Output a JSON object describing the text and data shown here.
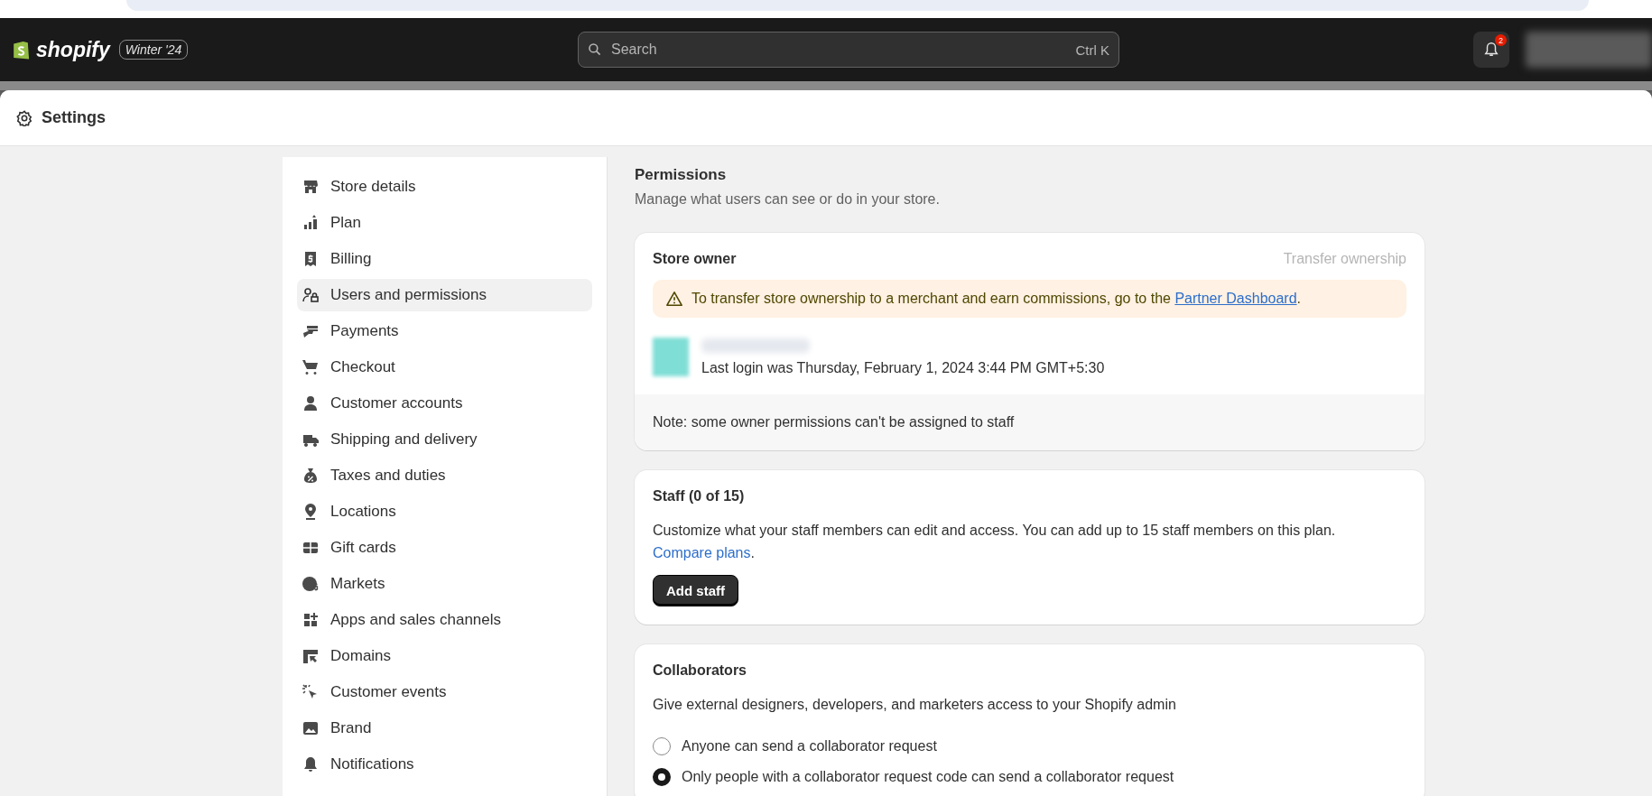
{
  "topbar": {
    "logo": "shopify",
    "edition": "Winter '24",
    "search": {
      "placeholder": "Search",
      "shortcut": "Ctrl K"
    },
    "notification_count": "2"
  },
  "header": {
    "title": "Settings"
  },
  "sidebar": {
    "items": [
      {
        "label": "Store details",
        "selected": false
      },
      {
        "label": "Plan",
        "selected": false
      },
      {
        "label": "Billing",
        "selected": false
      },
      {
        "label": "Users and permissions",
        "selected": true
      },
      {
        "label": "Payments",
        "selected": false
      },
      {
        "label": "Checkout",
        "selected": false
      },
      {
        "label": "Customer accounts",
        "selected": false
      },
      {
        "label": "Shipping and delivery",
        "selected": false
      },
      {
        "label": "Taxes and duties",
        "selected": false
      },
      {
        "label": "Locations",
        "selected": false
      },
      {
        "label": "Gift cards",
        "selected": false
      },
      {
        "label": "Markets",
        "selected": false
      },
      {
        "label": "Apps and sales channels",
        "selected": false
      },
      {
        "label": "Domains",
        "selected": false
      },
      {
        "label": "Customer events",
        "selected": false
      },
      {
        "label": "Brand",
        "selected": false
      },
      {
        "label": "Notifications",
        "selected": false
      }
    ]
  },
  "permissions": {
    "title": "Permissions",
    "subtitle": "Manage what users can see or do in your store."
  },
  "store_owner": {
    "title": "Store owner",
    "action": "Transfer ownership",
    "banner": {
      "text": "To transfer store ownership to a merchant and earn commissions, go to the ",
      "link": "Partner Dashboard",
      "end": "."
    },
    "last_login": "Last login was Thursday, February 1, 2024 3:44 PM GMT+5:30",
    "note": "Note: some owner permissions can't be assigned to staff"
  },
  "staff": {
    "title": "Staff (0 of 15)",
    "text": "Customize what your staff members can edit and access. You can add up to 15 staff members on this plan.",
    "link": "Compare plans",
    "link_end": ".",
    "button": "Add staff"
  },
  "collaborators": {
    "title": "Collaborators",
    "text": "Give external designers, developers, and marketers access to your Shopify admin",
    "options": [
      {
        "label": "Anyone can send a collaborator request",
        "selected": false
      },
      {
        "label": "Only people with a collaborator request code can send a collaborator request",
        "selected": true
      }
    ]
  }
}
